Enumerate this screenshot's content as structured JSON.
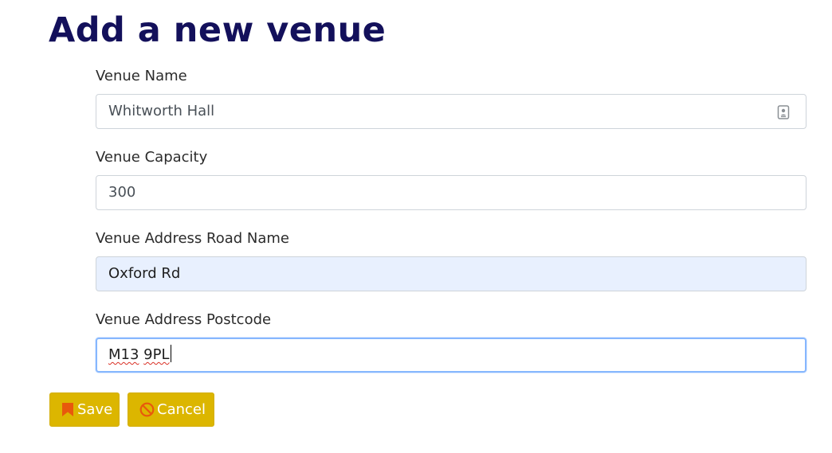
{
  "page": {
    "title": "Add a new venue"
  },
  "form": {
    "fields": [
      {
        "label": "Venue Name",
        "value": "Whitworth Hall",
        "icon": "contact-card-icon"
      },
      {
        "label": "Venue Capacity",
        "value": "300"
      },
      {
        "label": "Venue Address Road Name",
        "value": "Oxford Rd"
      },
      {
        "label": "Venue Address Postcode",
        "value_part1": "M13",
        "value_part2": "9PL"
      }
    ]
  },
  "actions": {
    "save_label": "Save",
    "save_icon": "bookmark-icon",
    "cancel_label": "Cancel",
    "cancel_icon": "prohibited-icon"
  },
  "colors": {
    "title": "#13105b",
    "button": "#dcb600",
    "button_text": "#ffffff",
    "autofill_bg": "#e8f0fe",
    "focus_border": "#86b7fe",
    "icon_accent": "#e8590c"
  }
}
